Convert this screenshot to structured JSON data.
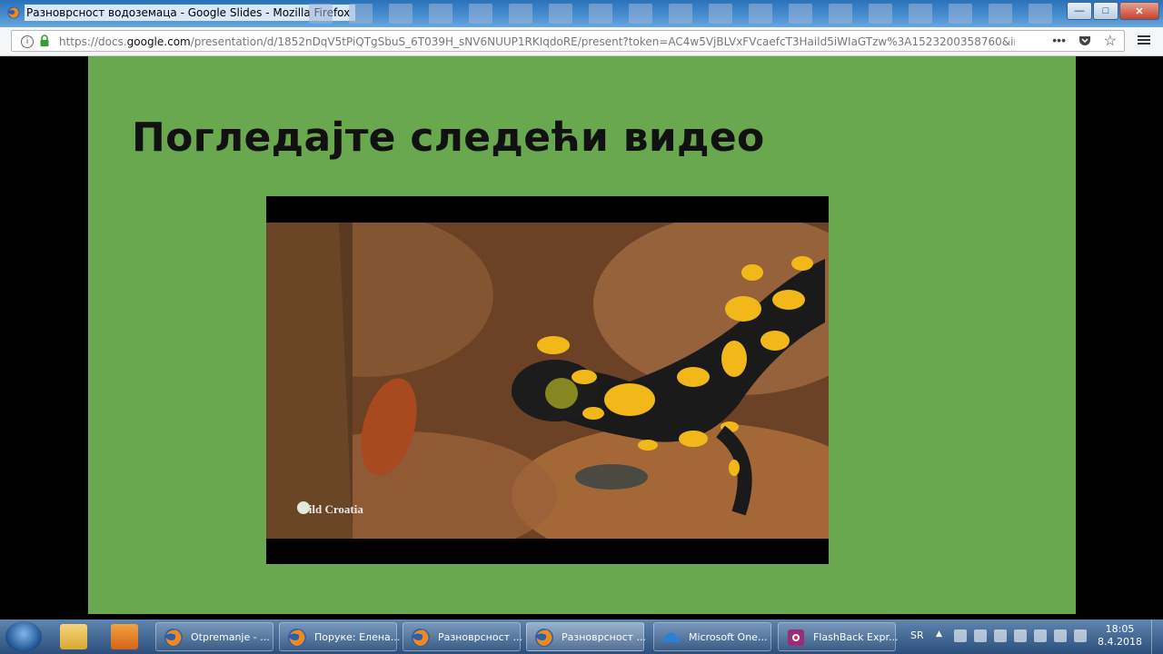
{
  "window": {
    "title": "Разноврсност водоземаца - Google Slides - Mozilla Firefox",
    "controls": {
      "minimize": "—",
      "maximize": "□",
      "close": "✕"
    }
  },
  "address_bar": {
    "url_prefix": "https://docs.",
    "url_domain": "google.com",
    "url_rest": "/presentation/d/1852nDqV5tPiQTgSbuS_6T039H_sNV6NUUP1RKIqdoRE/present?token=AC4w5VjBLVxFVcaefcT3Haild5iWIaGTzw%3A1523200358760&includes_info",
    "page_actions": "•••",
    "bookmark_star": "☆"
  },
  "slide": {
    "title": "Погледајте следећи видео",
    "video_watermark": "Wild Croatia"
  },
  "taskbar": {
    "items": [
      {
        "label": "Otpremanje - ...",
        "icon": "firefox-icon"
      },
      {
        "label": "Поруке: Елена...",
        "icon": "firefox-icon"
      },
      {
        "label": "Разноврсност ...",
        "icon": "firefox-icon"
      },
      {
        "label": "Разноврсност ...",
        "icon": "firefox-icon",
        "active": true
      },
      {
        "label": "Microsoft One...",
        "icon": "onedrive-icon"
      },
      {
        "label": "FlashBack Expr...",
        "icon": "flashback-icon"
      }
    ],
    "language": "SR",
    "time": "18:05",
    "date": "8.4.2018"
  },
  "colors": {
    "slide_background": "#6aa84f",
    "titlebar": "#4a8fd0",
    "taskbar": "#2b4f7a"
  }
}
